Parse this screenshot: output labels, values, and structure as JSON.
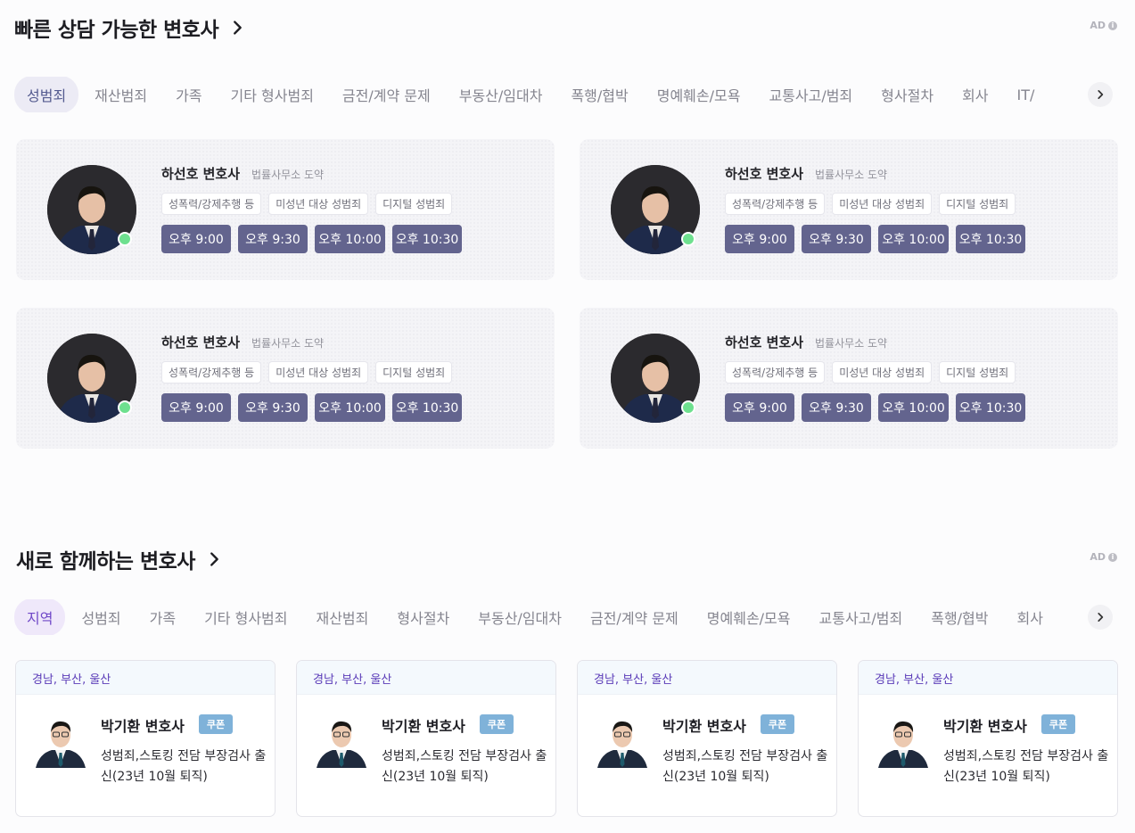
{
  "quick": {
    "title": "빠른 상담 가능한 변호사",
    "ad": "AD",
    "tabs": [
      "성범죄",
      "재산범죄",
      "가족",
      "기타 형사범죄",
      "금전/계약 문제",
      "부동산/임대차",
      "폭행/협박",
      "명예훼손/모욕",
      "교통사고/범죄",
      "형사절차",
      "회사",
      "IT/"
    ],
    "cards": [
      {
        "name": "하선호 변호사",
        "firm": "법률사무소 도약",
        "tags": [
          "성폭력/강제추행 등",
          "미성년 대상 성범죄",
          "디지털 성범죄"
        ],
        "slots": [
          "오후 9:00",
          "오후 9:30",
          "오후 10:00",
          "오후 10:30"
        ]
      },
      {
        "name": "하선호 변호사",
        "firm": "법률사무소 도약",
        "tags": [
          "성폭력/강제추행 등",
          "미성년 대상 성범죄",
          "디지털 성범죄"
        ],
        "slots": [
          "오후 9:00",
          "오후 9:30",
          "오후 10:00",
          "오후 10:30"
        ]
      },
      {
        "name": "하선호 변호사",
        "firm": "법률사무소 도약",
        "tags": [
          "성폭력/강제추행 등",
          "미성년 대상 성범죄",
          "디지털 성범죄"
        ],
        "slots": [
          "오후 9:00",
          "오후 9:30",
          "오후 10:00",
          "오후 10:30"
        ]
      },
      {
        "name": "하선호 변호사",
        "firm": "법률사무소 도약",
        "tags": [
          "성폭력/강제추행 등",
          "미성년 대상 성범죄",
          "디지털 성범죄"
        ],
        "slots": [
          "오후 9:00",
          "오후 9:30",
          "오후 10:00",
          "오후 10:30"
        ]
      }
    ]
  },
  "newLawyers": {
    "title": "새로 함께하는 변호사",
    "ad": "AD",
    "tabs": [
      "지역",
      "성범죄",
      "가족",
      "기타 형사범죄",
      "재산범죄",
      "형사절차",
      "부동산/임대차",
      "금전/계약 문제",
      "명예훼손/모욕",
      "교통사고/범죄",
      "폭행/협박",
      "회사"
    ],
    "cards": [
      {
        "region": "경남, 부산, 울산",
        "name": "박기환 변호사",
        "coupon": "쿠폰",
        "desc": "성범죄,스토킹 전담 부장검사 출신(23년 10월 퇴직)"
      },
      {
        "region": "경남, 부산, 울산",
        "name": "박기환 변호사",
        "coupon": "쿠폰",
        "desc": "성범죄,스토킹 전담 부장검사 출신(23년 10월 퇴직)"
      },
      {
        "region": "경남, 부산, 울산",
        "name": "박기환 변호사",
        "coupon": "쿠폰",
        "desc": "성범죄,스토킹 전담 부장검사 출신(23년 10월 퇴직)"
      },
      {
        "region": "경남, 부산, 울산",
        "name": "박기환 변호사",
        "coupon": "쿠폰",
        "desc": "성범죄,스토킹 전담 부장검사 출신(23년 10월 퇴직)"
      }
    ]
  },
  "colors": {
    "slot": "#63648e",
    "online": "#6ee08f",
    "activeTab1": "#535a8f",
    "activeTab2": "#7048c8",
    "coupon": "#7fb2d9"
  },
  "icons": {
    "title_chevron": "chevron-right-icon",
    "tab_next": "chevron-right-icon",
    "ad_info": "info-icon",
    "online": "online-status-dot"
  }
}
